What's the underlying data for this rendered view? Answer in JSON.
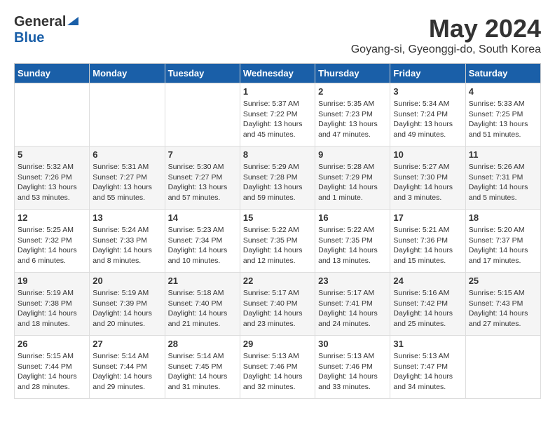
{
  "header": {
    "logo_general": "General",
    "logo_blue": "Blue",
    "month": "May 2024",
    "location": "Goyang-si, Gyeonggi-do, South Korea"
  },
  "days_of_week": [
    "Sunday",
    "Monday",
    "Tuesday",
    "Wednesday",
    "Thursday",
    "Friday",
    "Saturday"
  ],
  "weeks": [
    [
      {
        "day": "",
        "info": ""
      },
      {
        "day": "",
        "info": ""
      },
      {
        "day": "",
        "info": ""
      },
      {
        "day": "1",
        "info": "Sunrise: 5:37 AM\nSunset: 7:22 PM\nDaylight: 13 hours\nand 45 minutes."
      },
      {
        "day": "2",
        "info": "Sunrise: 5:35 AM\nSunset: 7:23 PM\nDaylight: 13 hours\nand 47 minutes."
      },
      {
        "day": "3",
        "info": "Sunrise: 5:34 AM\nSunset: 7:24 PM\nDaylight: 13 hours\nand 49 minutes."
      },
      {
        "day": "4",
        "info": "Sunrise: 5:33 AM\nSunset: 7:25 PM\nDaylight: 13 hours\nand 51 minutes."
      }
    ],
    [
      {
        "day": "5",
        "info": "Sunrise: 5:32 AM\nSunset: 7:26 PM\nDaylight: 13 hours\nand 53 minutes."
      },
      {
        "day": "6",
        "info": "Sunrise: 5:31 AM\nSunset: 7:27 PM\nDaylight: 13 hours\nand 55 minutes."
      },
      {
        "day": "7",
        "info": "Sunrise: 5:30 AM\nSunset: 7:27 PM\nDaylight: 13 hours\nand 57 minutes."
      },
      {
        "day": "8",
        "info": "Sunrise: 5:29 AM\nSunset: 7:28 PM\nDaylight: 13 hours\nand 59 minutes."
      },
      {
        "day": "9",
        "info": "Sunrise: 5:28 AM\nSunset: 7:29 PM\nDaylight: 14 hours\nand 1 minute."
      },
      {
        "day": "10",
        "info": "Sunrise: 5:27 AM\nSunset: 7:30 PM\nDaylight: 14 hours\nand 3 minutes."
      },
      {
        "day": "11",
        "info": "Sunrise: 5:26 AM\nSunset: 7:31 PM\nDaylight: 14 hours\nand 5 minutes."
      }
    ],
    [
      {
        "day": "12",
        "info": "Sunrise: 5:25 AM\nSunset: 7:32 PM\nDaylight: 14 hours\nand 6 minutes."
      },
      {
        "day": "13",
        "info": "Sunrise: 5:24 AM\nSunset: 7:33 PM\nDaylight: 14 hours\nand 8 minutes."
      },
      {
        "day": "14",
        "info": "Sunrise: 5:23 AM\nSunset: 7:34 PM\nDaylight: 14 hours\nand 10 minutes."
      },
      {
        "day": "15",
        "info": "Sunrise: 5:22 AM\nSunset: 7:35 PM\nDaylight: 14 hours\nand 12 minutes."
      },
      {
        "day": "16",
        "info": "Sunrise: 5:22 AM\nSunset: 7:35 PM\nDaylight: 14 hours\nand 13 minutes."
      },
      {
        "day": "17",
        "info": "Sunrise: 5:21 AM\nSunset: 7:36 PM\nDaylight: 14 hours\nand 15 minutes."
      },
      {
        "day": "18",
        "info": "Sunrise: 5:20 AM\nSunset: 7:37 PM\nDaylight: 14 hours\nand 17 minutes."
      }
    ],
    [
      {
        "day": "19",
        "info": "Sunrise: 5:19 AM\nSunset: 7:38 PM\nDaylight: 14 hours\nand 18 minutes."
      },
      {
        "day": "20",
        "info": "Sunrise: 5:19 AM\nSunset: 7:39 PM\nDaylight: 14 hours\nand 20 minutes."
      },
      {
        "day": "21",
        "info": "Sunrise: 5:18 AM\nSunset: 7:40 PM\nDaylight: 14 hours\nand 21 minutes."
      },
      {
        "day": "22",
        "info": "Sunrise: 5:17 AM\nSunset: 7:40 PM\nDaylight: 14 hours\nand 23 minutes."
      },
      {
        "day": "23",
        "info": "Sunrise: 5:17 AM\nSunset: 7:41 PM\nDaylight: 14 hours\nand 24 minutes."
      },
      {
        "day": "24",
        "info": "Sunrise: 5:16 AM\nSunset: 7:42 PM\nDaylight: 14 hours\nand 25 minutes."
      },
      {
        "day": "25",
        "info": "Sunrise: 5:15 AM\nSunset: 7:43 PM\nDaylight: 14 hours\nand 27 minutes."
      }
    ],
    [
      {
        "day": "26",
        "info": "Sunrise: 5:15 AM\nSunset: 7:44 PM\nDaylight: 14 hours\nand 28 minutes."
      },
      {
        "day": "27",
        "info": "Sunrise: 5:14 AM\nSunset: 7:44 PM\nDaylight: 14 hours\nand 29 minutes."
      },
      {
        "day": "28",
        "info": "Sunrise: 5:14 AM\nSunset: 7:45 PM\nDaylight: 14 hours\nand 31 minutes."
      },
      {
        "day": "29",
        "info": "Sunrise: 5:13 AM\nSunset: 7:46 PM\nDaylight: 14 hours\nand 32 minutes."
      },
      {
        "day": "30",
        "info": "Sunrise: 5:13 AM\nSunset: 7:46 PM\nDaylight: 14 hours\nand 33 minutes."
      },
      {
        "day": "31",
        "info": "Sunrise: 5:13 AM\nSunset: 7:47 PM\nDaylight: 14 hours\nand 34 minutes."
      },
      {
        "day": "",
        "info": ""
      }
    ]
  ]
}
